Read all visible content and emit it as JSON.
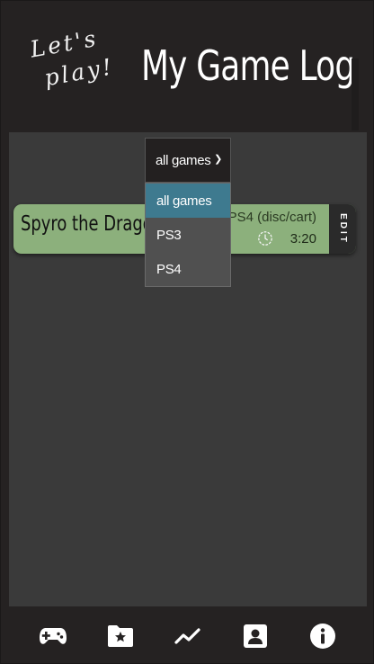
{
  "header": {
    "tagline_line1": "Let's",
    "tagline_line2": "play!",
    "title": "My Game Log"
  },
  "filter": {
    "selected": "all games",
    "options": [
      "all games",
      "PS3",
      "PS4"
    ]
  },
  "games": [
    {
      "title": "Spyro the Dragon",
      "platform": "PS4 (disc/cart)",
      "time": "3:20",
      "edit_label": "EDIT",
      "card_color": "#8cb07c"
    }
  ],
  "bottom_nav": [
    {
      "icon": "gamepad-plus-icon"
    },
    {
      "icon": "folder-star-icon"
    },
    {
      "icon": "trend-line-icon"
    },
    {
      "icon": "profile-icon"
    },
    {
      "icon": "info-icon"
    }
  ],
  "colors": {
    "background": "#252222",
    "panel": "#3a3a3a",
    "dropdown_highlight": "#3e7a8f"
  }
}
